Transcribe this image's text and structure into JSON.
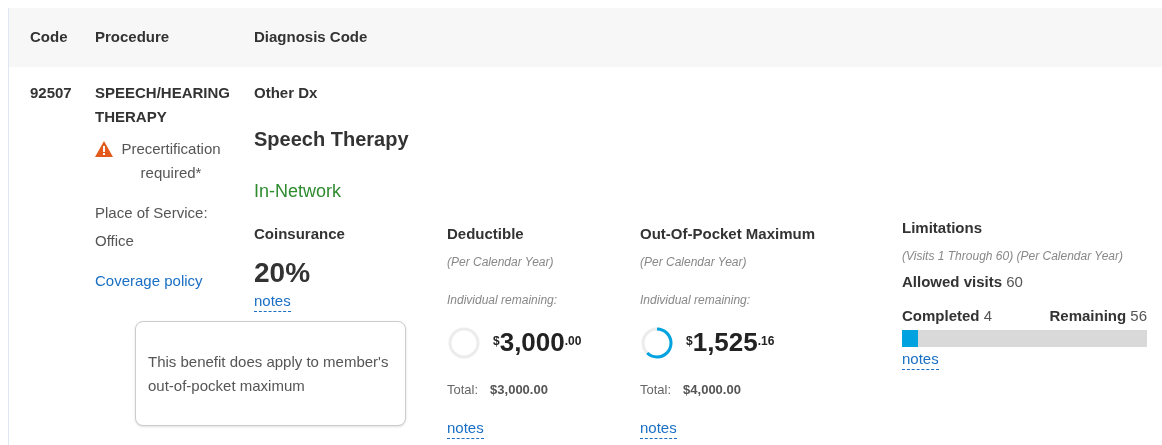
{
  "table": {
    "columns": [
      "Code",
      "Procedure",
      "Diagnosis Code"
    ],
    "row": {
      "code": "92507",
      "procedure": "SPEECH/HEARING THERAPY",
      "warning": "Precertification required*",
      "place_label": "Place of Service:",
      "place_value": "Office",
      "coverage_link": "Coverage policy",
      "diagnosis": "Other Dx",
      "service": "Speech Therapy",
      "network": "In-Network",
      "coinsurance": {
        "title": "Coinsurance",
        "value": "20%",
        "notes": "notes",
        "tooltip": "This benefit does apply to member's out-of-pocket maximum"
      },
      "amounts": [
        {
          "title": "Deductible",
          "period": "(Per Calendar Year)",
          "remaining_label": "Individual remaining:",
          "currency": "$",
          "whole": "3,000",
          "cents": ".00",
          "total_label": "Total:",
          "total": "$3,000.00",
          "notes": "notes"
        },
        {
          "title": "Out-Of-Pocket Maximum",
          "period": "(Per Calendar Year)",
          "remaining_label": "Individual remaining:",
          "currency": "$",
          "whole": "1,525",
          "cents": ".16",
          "total_label": "Total:",
          "total": "$4,000.00",
          "notes": "notes"
        }
      ],
      "limitations": {
        "title": "Limitations",
        "period": "(Visits 1 Through 60) (Per Calendar Year)",
        "allowed_label": "Allowed visits",
        "allowed": "60",
        "completed_label": "Completed",
        "completed": "4",
        "remaining_label": "Remaining",
        "remaining": "56",
        "level": 0.067,
        "notes": "notes"
      }
    }
  }
}
